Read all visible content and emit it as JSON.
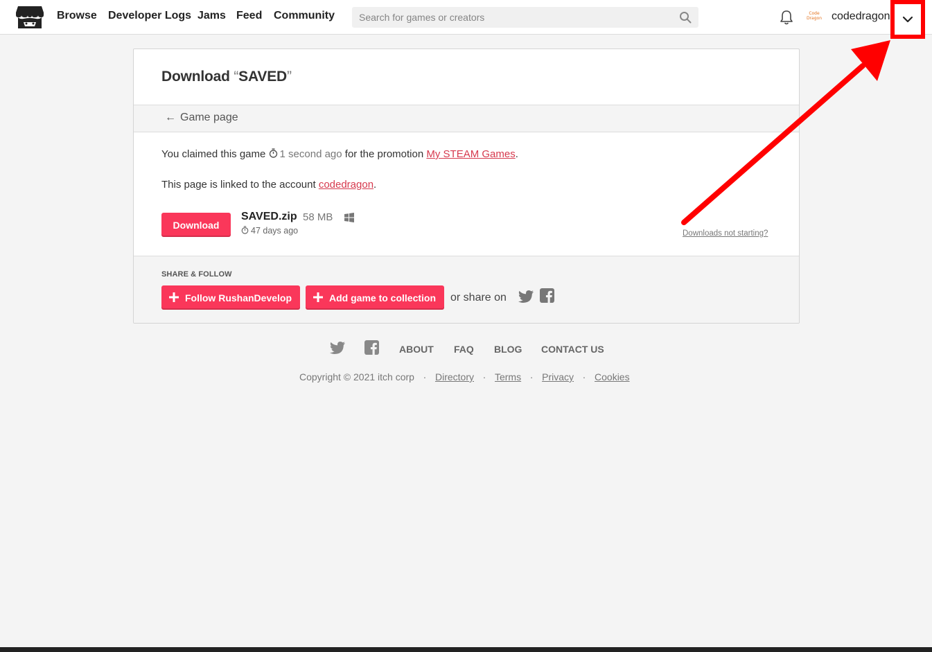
{
  "header": {
    "nav": [
      "Browse",
      "Developer Logs",
      "Jams",
      "Feed",
      "Community"
    ],
    "search_placeholder": "Search for games or creators",
    "avatar_text_line1": "Code",
    "avatar_text_line2": "Dragon",
    "username": "codedragon"
  },
  "card": {
    "title_prefix": "Download",
    "title_open_quote": "“",
    "title_game": "SAVED",
    "title_close_quote": "”",
    "back_arrow": "←",
    "back_label": "Game page",
    "claim_prefix": "You claimed this game",
    "claim_time": "1 second ago",
    "claim_middle": "for the promotion",
    "promotion_link": "My STEAM Games",
    "claim_suffix": ".",
    "linked_prefix": "This page is linked to the account",
    "linked_account": "codedragon",
    "linked_suffix": ".",
    "download_label": "Download",
    "file_name": "SAVED.zip",
    "file_size": "58 MB",
    "file_date": "47 days ago",
    "not_starting": "Downloads not starting?",
    "share_title": "SHARE & FOLLOW",
    "follow_label": "Follow RushanDevelop",
    "collection_label": "Add game to collection",
    "share_on": "or share on"
  },
  "footer": {
    "links": [
      "ABOUT",
      "FAQ",
      "BLOG",
      "CONTACT US"
    ],
    "copyright": "Copyright © 2021 itch corp",
    "sep": "·",
    "bottom_links": [
      "Directory",
      "Terms",
      "Privacy",
      "Cookies"
    ]
  },
  "colors": {
    "accent": "#fa375a",
    "link": "#d6394d",
    "annotation": "#ff0000"
  },
  "icons": [
    "itch-logo",
    "search-icon",
    "bell-icon",
    "chevron-down-icon",
    "stopwatch-icon",
    "windows-icon",
    "plus-icon",
    "twitter-icon",
    "facebook-icon",
    "arrow-left-icon"
  ]
}
